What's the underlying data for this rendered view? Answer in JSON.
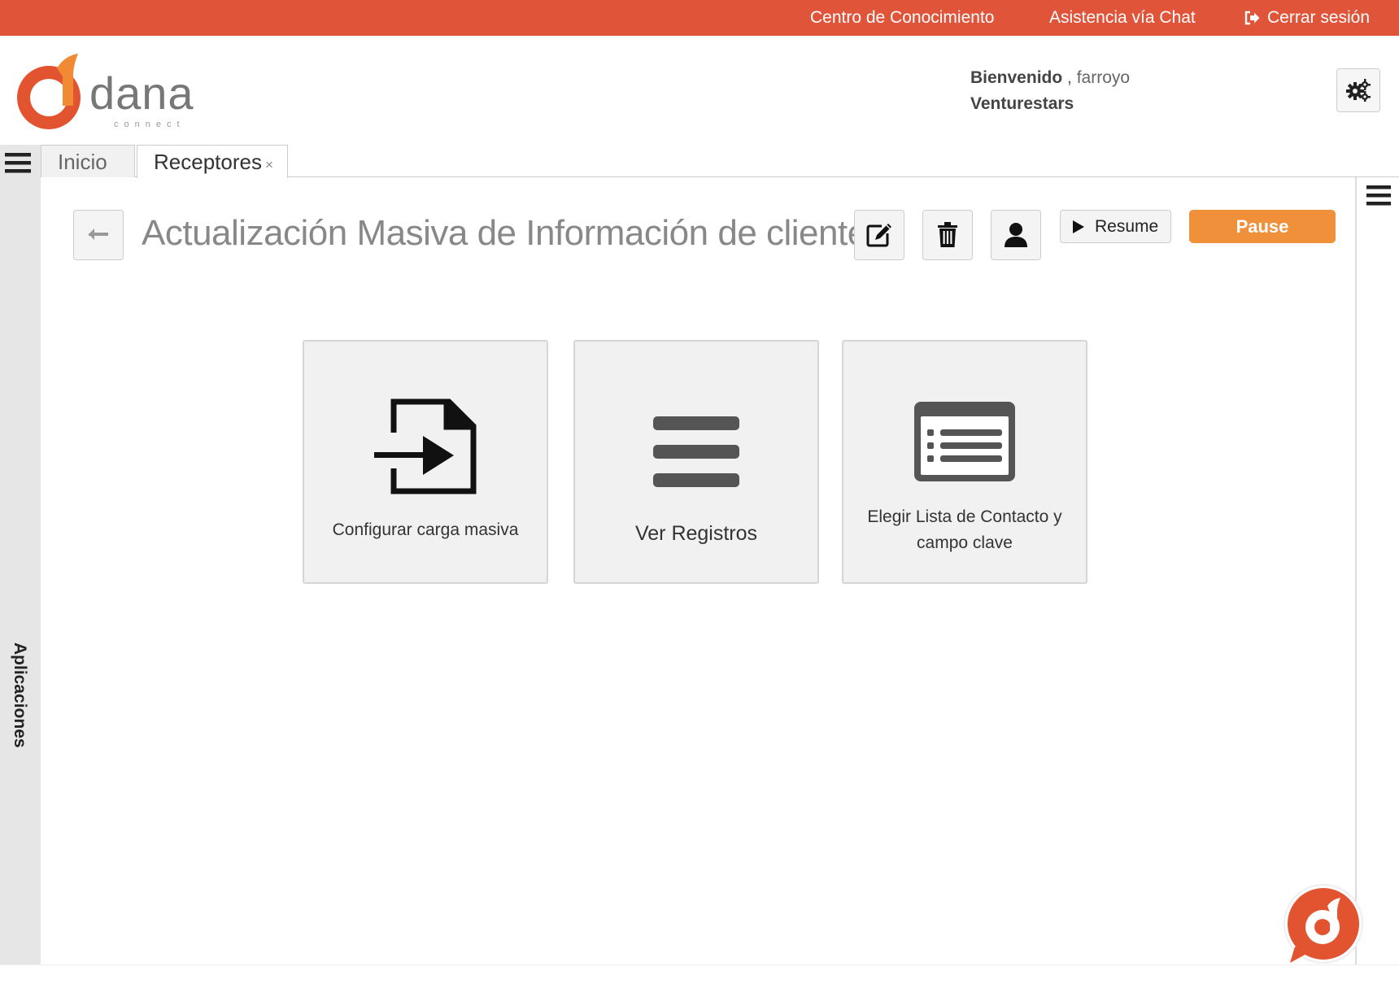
{
  "topbar": {
    "knowledge_center": "Centro de Conocimiento",
    "chat_support": "Asistencia vía Chat",
    "logout": "Cerrar sesión"
  },
  "brand": {
    "name": "dana",
    "tagline": "connect",
    "color": "#e0553a"
  },
  "header": {
    "welcome_label": "Bienvenido",
    "separator": ",",
    "username": "farroyo",
    "company": "Venturestars"
  },
  "sidebar": {
    "label": "Aplicaciones"
  },
  "tabs": [
    {
      "label": "Inicio",
      "active": false
    },
    {
      "label": "Receptores",
      "active": true,
      "close": "×"
    }
  ],
  "page": {
    "title": "Actualización Masiva de Información de clientes"
  },
  "toolbar": {
    "resume_label": "Resume",
    "pause_label": "Pause",
    "pause_color": "#f0903a"
  },
  "cards": [
    {
      "label": "Configurar carga masiva",
      "icon": "file-import-icon"
    },
    {
      "label": "Ver Registros",
      "icon": "list-bars-icon"
    },
    {
      "label_line1": "Elegir Lista de Contacto y",
      "label_line2": "campo clave",
      "icon": "contact-list-icon"
    }
  ]
}
